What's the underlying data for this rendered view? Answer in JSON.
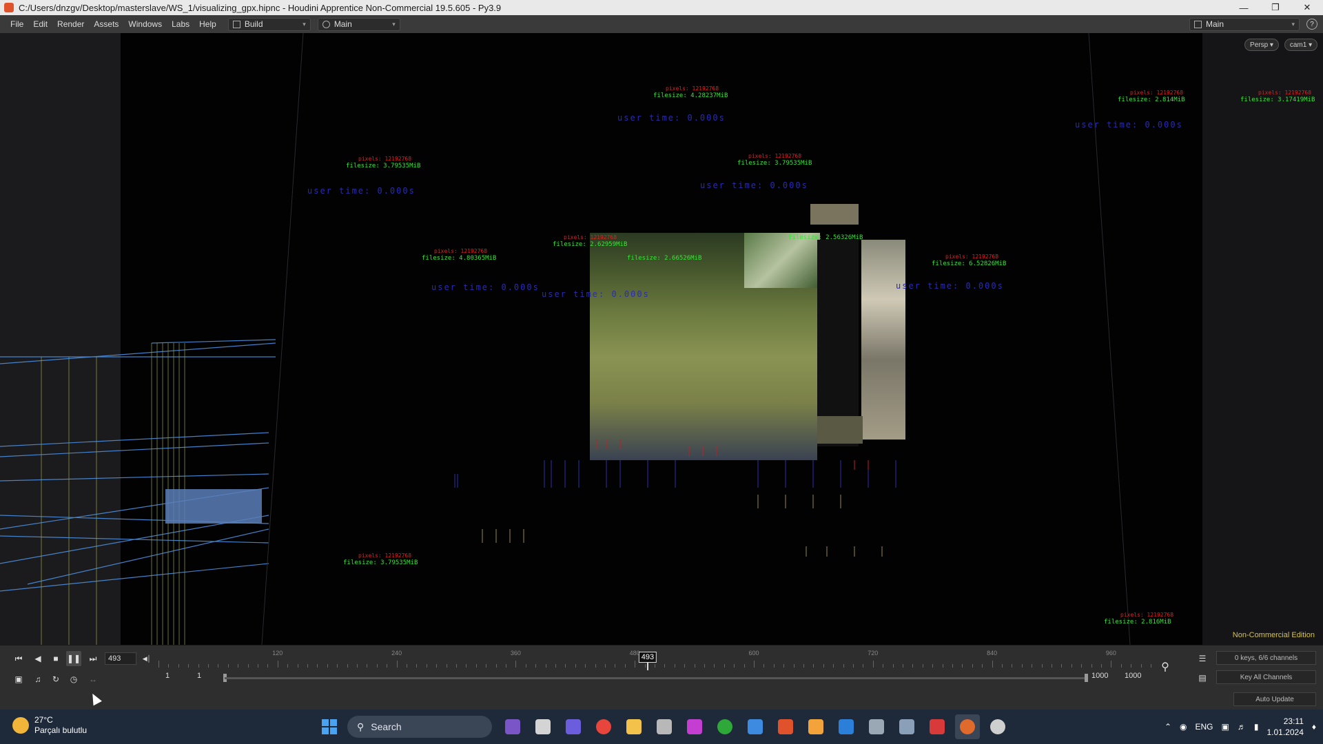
{
  "window": {
    "title": "C:/Users/dnzgv/Desktop/masterslave/WS_1/visualizing_gpx.hipnc - Houdini Apprentice Non-Commercial 19.5.605 - Py3.9",
    "minimize": "—",
    "maximize": "❐",
    "close": "✕"
  },
  "menubar": {
    "items": [
      "File",
      "Edit",
      "Render",
      "Assets",
      "Windows",
      "Labs",
      "Help"
    ],
    "desktop_left": "Build",
    "desktop_mid": "Main",
    "desktop_right": "Main",
    "help_icon": "?"
  },
  "viewport": {
    "camera_button": "Persp ▾",
    "cam_button": "cam1 ▾",
    "non_commercial": "Non-Commercial Edition",
    "annotations": {
      "red_pixels": "pixels: 12192768",
      "green": [
        "filesize: 4.28237MiB",
        "filesize: 3.79535MiB",
        "filesize: 3.79535MiB",
        "filesize: 2.814MiB",
        "filesize: 3.17419MiB",
        "filesize: 6.52826MiB",
        "filesize: 2.62959MiB",
        "filesize: 2.56326MiB",
        "filesize: 4.80365MiB",
        "filesize: 2.66526MiB",
        "filesize: 3.79535MiB",
        "filesize: 2.816MiB"
      ],
      "blue_user_time": "user time: 0.000s"
    }
  },
  "timeline": {
    "current_frame": "493",
    "playhead_label": "493",
    "tick_labels": [
      "120",
      "240",
      "360",
      "480",
      "600",
      "720",
      "840",
      "960"
    ],
    "range_start_a": "1",
    "range_start_b": "1",
    "range_end_a": "1000",
    "range_end_b": "1000",
    "keys_info": "0 keys, 6/6 channels",
    "key_all": "Key All Channels",
    "auto_update": "Auto Update"
  },
  "taskbar": {
    "weather_temp": "27°C",
    "weather_desc": "Parçalı bulutlu",
    "search_placeholder": "Search",
    "language": "ENG",
    "time": "23:11",
    "date": "1.01.2024",
    "app_colors": [
      "#7a55c8",
      "#d4d4d4",
      "#6b5ddc",
      "#e8453c",
      "#f3c24a",
      "#b8b8b8",
      "#c43fd1",
      "#2fa83a",
      "#3c8be0",
      "#e0522b",
      "#f2a33a",
      "#2b7fd8",
      "#9aa7b4",
      "#8aa0b8",
      "#d83a3a",
      "#e06a2b",
      "#cfcfcf"
    ]
  }
}
